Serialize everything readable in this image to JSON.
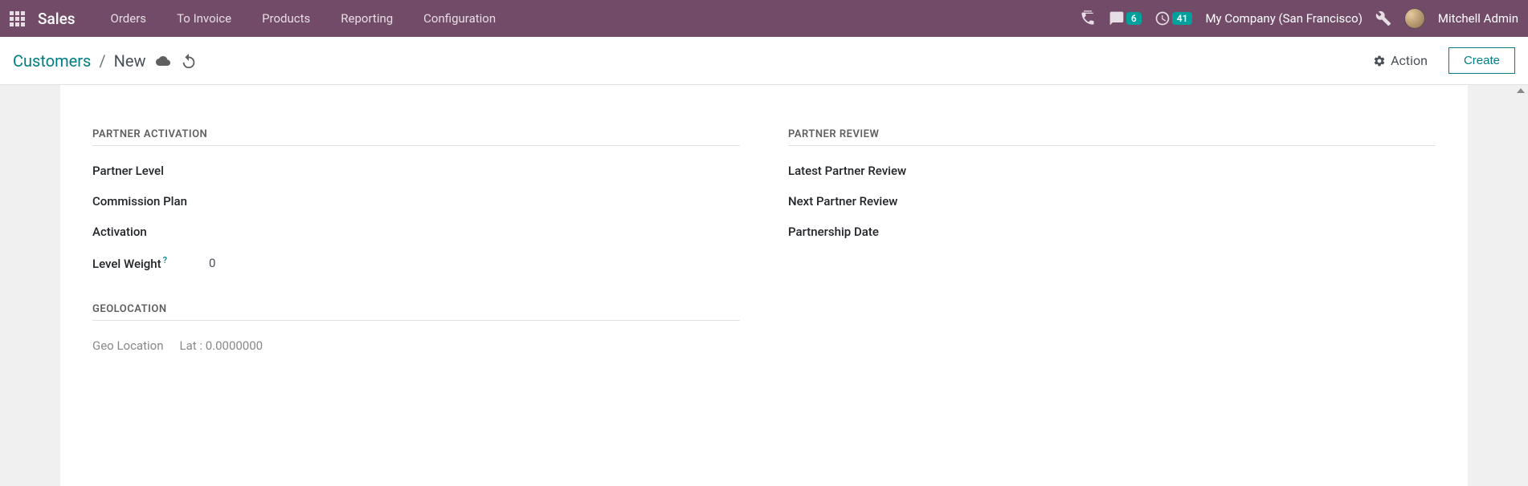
{
  "topbar": {
    "app_title": "Sales",
    "nav": {
      "orders": "Orders",
      "to_invoice": "To Invoice",
      "products": "Products",
      "reporting": "Reporting",
      "configuration": "Configuration"
    },
    "messages_badge": "6",
    "activities_badge": "41",
    "company": "My Company (San Francisco)",
    "user": "Mitchell Admin"
  },
  "controlbar": {
    "breadcrumb_parent": "Customers",
    "breadcrumb_current": "New",
    "action_label": "Action",
    "create_label": "Create"
  },
  "form": {
    "partner_activation": {
      "title": "PARTNER ACTIVATION",
      "partner_level_label": "Partner Level",
      "commission_plan_label": "Commission Plan",
      "activation_label": "Activation",
      "level_weight_label": "Level Weight",
      "level_weight_help": "?",
      "level_weight_value": "0"
    },
    "partner_review": {
      "title": "PARTNER REVIEW",
      "latest_label": "Latest Partner Review",
      "next_label": "Next Partner Review",
      "partnership_date_label": "Partnership Date"
    },
    "geolocation": {
      "title": "GEOLOCATION",
      "geo_location_label": "Geo Location",
      "lat_text": "Lat : 0.0000000"
    }
  }
}
